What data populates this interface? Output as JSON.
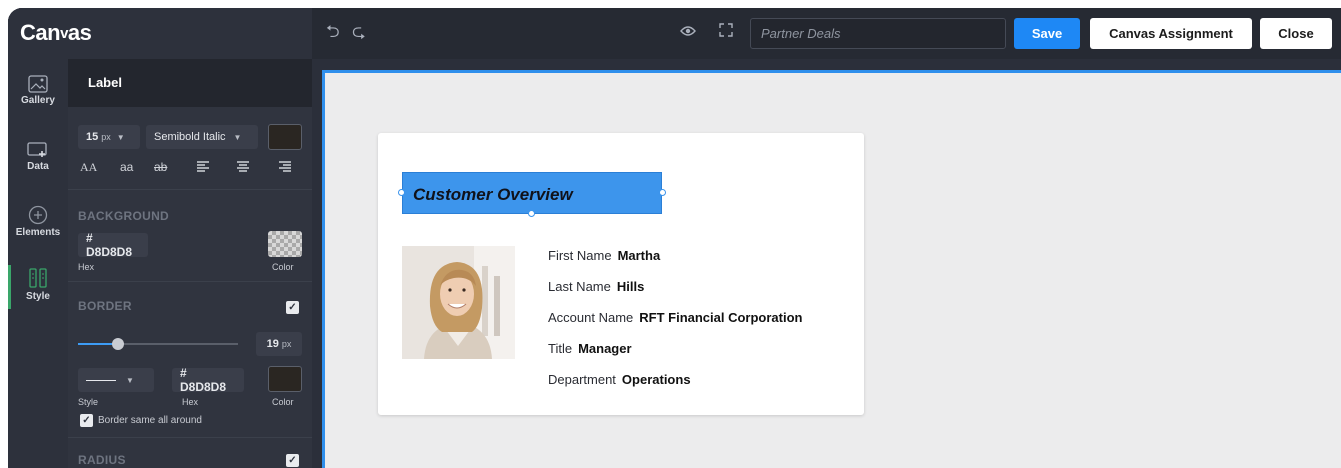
{
  "app": {
    "logo_text": "Canvas",
    "logo_main": "Can",
    "logo_glyph": "v",
    "logo_end": "as"
  },
  "toolbar": {
    "undo_icon": "undo-icon",
    "redo_icon": "redo-icon",
    "preview_icon": "eye-icon",
    "fullscreen_icon": "expand-icon",
    "search_placeholder": "Partner Deals",
    "save_label": "Save",
    "assign_label": "Canvas Assignment",
    "close_label": "Close"
  },
  "rail": {
    "items": [
      {
        "label": "Gallery",
        "icon": "gallery-icon"
      },
      {
        "label": "Data",
        "icon": "data-icon"
      },
      {
        "label": "Elements",
        "icon": "elements-icon"
      },
      {
        "label": "Style",
        "icon": "style-icon",
        "active": true
      }
    ]
  },
  "panel": {
    "title": "Label",
    "font_size": "15",
    "font_size_unit": "px",
    "font_style": "Semibold Italic",
    "text_case": [
      "AA",
      "aa",
      "ab"
    ],
    "background": {
      "title": "BACKGROUND",
      "hex": "# D8D8D8",
      "hex_label": "Hex",
      "color_label": "Color"
    },
    "border": {
      "title": "BORDER",
      "width": "19",
      "width_unit": "px",
      "slider_fraction": 0.25,
      "style_label": "Style",
      "hex": "# D8D8D8",
      "hex_label": "Hex",
      "color_label": "Color",
      "same_all_around": "Border same all around"
    },
    "radius": {
      "title": "RADIUS"
    }
  },
  "card": {
    "heading": "Customer Overview",
    "fields": [
      {
        "label": "First Name",
        "value": "Martha"
      },
      {
        "label": "Last Name",
        "value": "Hills"
      },
      {
        "label": "Account Name",
        "value": "RFT Financial Corporation"
      },
      {
        "label": "Title",
        "value": "Manager"
      },
      {
        "label": "Department",
        "value": "Operations"
      }
    ]
  },
  "colors": {
    "accent": "#1e88f5",
    "selection": "#3d95ec",
    "active_rail": "#3aa66a"
  }
}
